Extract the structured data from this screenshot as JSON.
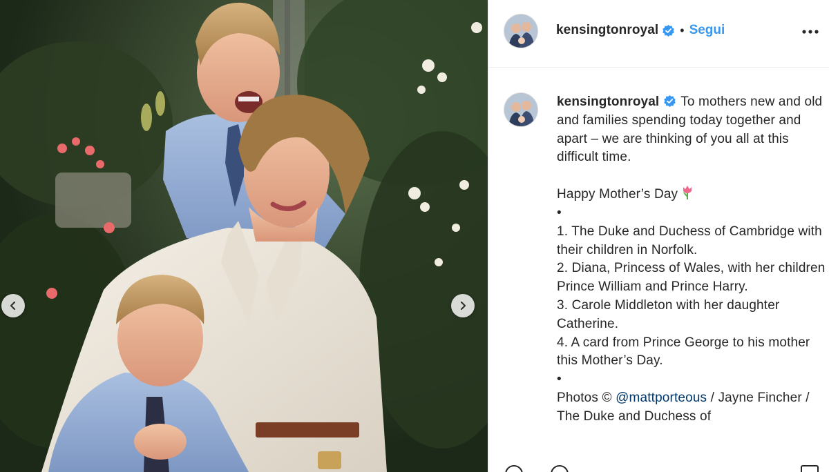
{
  "photo": {
    "alt_icon": "photo-of-mother-with-two-boys",
    "nav_prev_icon": "chevron-left-icon",
    "nav_next_icon": "chevron-right-icon"
  },
  "header": {
    "username": "kensingtonroyal",
    "verified_icon": "verified-badge-icon",
    "separator": "•",
    "follow_label": "Segui",
    "more_icon": "more-options-icon"
  },
  "caption": {
    "username": "kensingtonroyal",
    "intro": "To mothers new and old and families spending today together and apart – we are thinking of you all at this difficult time.",
    "greeting": "Happy Mother’s Day",
    "greeting_emoji": "tulip-icon",
    "bullet1": "•",
    "items": [
      "1. The Duke and Duchess of Cambridge with their children in Norfolk.",
      "2. Diana, Princess of Wales, with her children Prince William and Prince Harry.",
      "3. Carole Middleton with her daughter Catherine.",
      "4. A card from Prince George to his mother this Mother’s Day."
    ],
    "bullet2": "•",
    "photos_prefix": "Photos ©",
    "mention": "@mattporteous",
    "photos_suffix": "/ Jayne Fincher / The Duke and Duchess of"
  },
  "colors": {
    "link": "#3897f0",
    "mention": "#00376b",
    "text": "#262626",
    "border": "#efefef"
  }
}
